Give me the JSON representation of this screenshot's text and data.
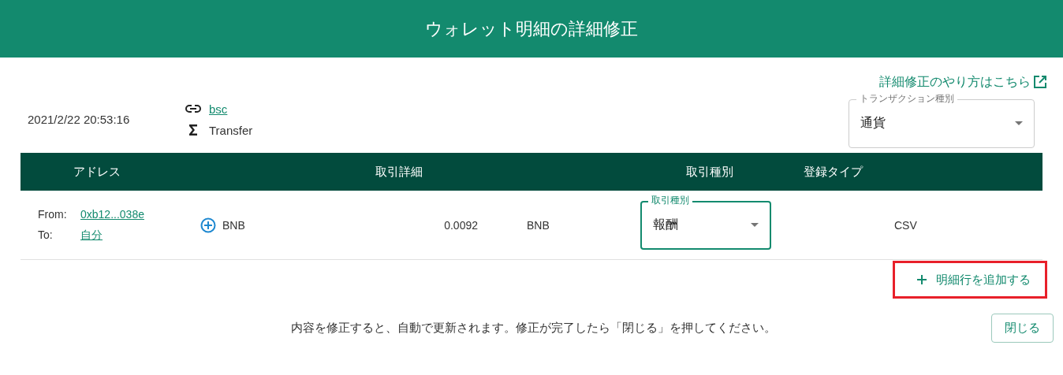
{
  "dialog": {
    "title": "ウォレット明細の詳細修正",
    "help_link": "詳細修正のやり方はこちら",
    "timestamp": "2021/2/22 20:53:16",
    "chain_link": "bsc",
    "method": "Transfer",
    "transaction_type": {
      "label": "トランザクション種別",
      "value": "通貨",
      "focused": false
    }
  },
  "table": {
    "columns": [
      "アドレス",
      "取引詳細",
      "取引種別",
      "登録タイプ"
    ],
    "rows": [
      {
        "from_label": "From:",
        "from": "0xb12...038e",
        "to_label": "To:",
        "to": "自分",
        "asset": "BNB",
        "amount": "0.0092",
        "currency": "BNB",
        "type": {
          "label": "取引種別",
          "value": "報酬",
          "focused": true
        },
        "registration": "CSV"
      }
    ]
  },
  "add_row_button": {
    "label": "明細行を追加する",
    "highlighted": true
  },
  "footer": {
    "note": "内容を修正すると、自動で更新されます。修正が完了したら「閉じる」を押してください。",
    "close_button": "閉じる"
  }
}
